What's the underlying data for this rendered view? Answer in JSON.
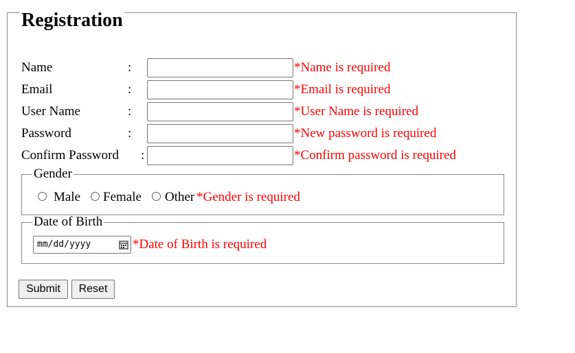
{
  "form": {
    "legend": "Registration",
    "fields": [
      {
        "label": "Name",
        "colon": ":",
        "value": "",
        "error": "*Name is required"
      },
      {
        "label": "Email",
        "colon": ":",
        "value": "",
        "error": "*Email is required"
      },
      {
        "label": "User Name",
        "colon": ":",
        "value": "",
        "error": "*User Name is required"
      },
      {
        "label": "Password",
        "colon": ":",
        "value": "",
        "error": "*New password is required"
      },
      {
        "label": "Confirm Password",
        "colon": ":",
        "value": "",
        "error": "*Confirm password is required"
      }
    ],
    "gender": {
      "legend": "Gender",
      "options": [
        "Male",
        "Female",
        "Other"
      ],
      "selected": null,
      "error": "*Gender is required"
    },
    "dob": {
      "legend": "Date of Birth",
      "placeholder": "mm/dd/yyyy",
      "error": "*Date of Birth is required"
    },
    "buttons": {
      "submit": "Submit",
      "reset": "Reset"
    }
  },
  "colors": {
    "error": "#ff0000",
    "border": "#8a8a8a",
    "button_bg": "#efefef"
  },
  "icons": {
    "date_picker": "calendar-icon"
  }
}
